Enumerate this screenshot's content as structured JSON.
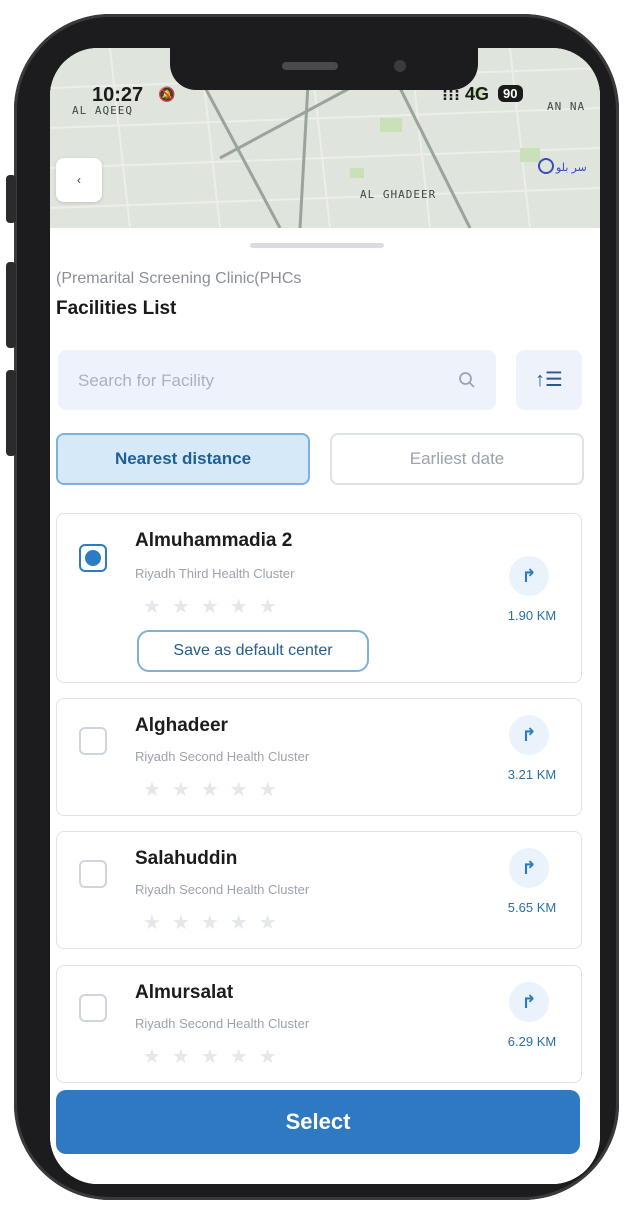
{
  "status_bar": {
    "time": "10:27",
    "signal": "4G",
    "battery": "90"
  },
  "map": {
    "labels": [
      "AL AQEEQ",
      "AL GHADEER",
      "AN NA"
    ],
    "poi_label": "سر بلو",
    "back_icon": "chevron-left-icon"
  },
  "sheet": {
    "subtitle": "(Premarital Screening Clinic(PHCs",
    "title": "Facilities List",
    "search_placeholder": "Search for Facility",
    "search_icon": "search-icon",
    "sort_icon": "sort-icon",
    "tabs": [
      {
        "label": "Nearest distance",
        "active": true
      },
      {
        "label": "Earliest date",
        "active": false
      }
    ]
  },
  "facilities": [
    {
      "name": "Almuhammadia 2",
      "cluster": "Riyadh Third Health Cluster",
      "distance": "1.90 KM",
      "rating": 0,
      "selected": true,
      "default_label": "Save as default center"
    },
    {
      "name": "Alghadeer",
      "cluster": "Riyadh Second Health Cluster",
      "distance": "3.21 KM",
      "rating": 0,
      "selected": false
    },
    {
      "name": "Salahuddin",
      "cluster": "Riyadh Second Health Cluster",
      "distance": "5.65 KM",
      "rating": 0,
      "selected": false
    },
    {
      "name": "Almursalat",
      "cluster": "Riyadh Second Health Cluster",
      "distance": "6.29 KM",
      "rating": 0,
      "selected": false
    }
  ],
  "actions": {
    "select_label": "Select"
  },
  "colors": {
    "primary": "#2f79c2",
    "tab_active_bg": "#d6e9f8",
    "map_bg": "#dfe4dc"
  }
}
